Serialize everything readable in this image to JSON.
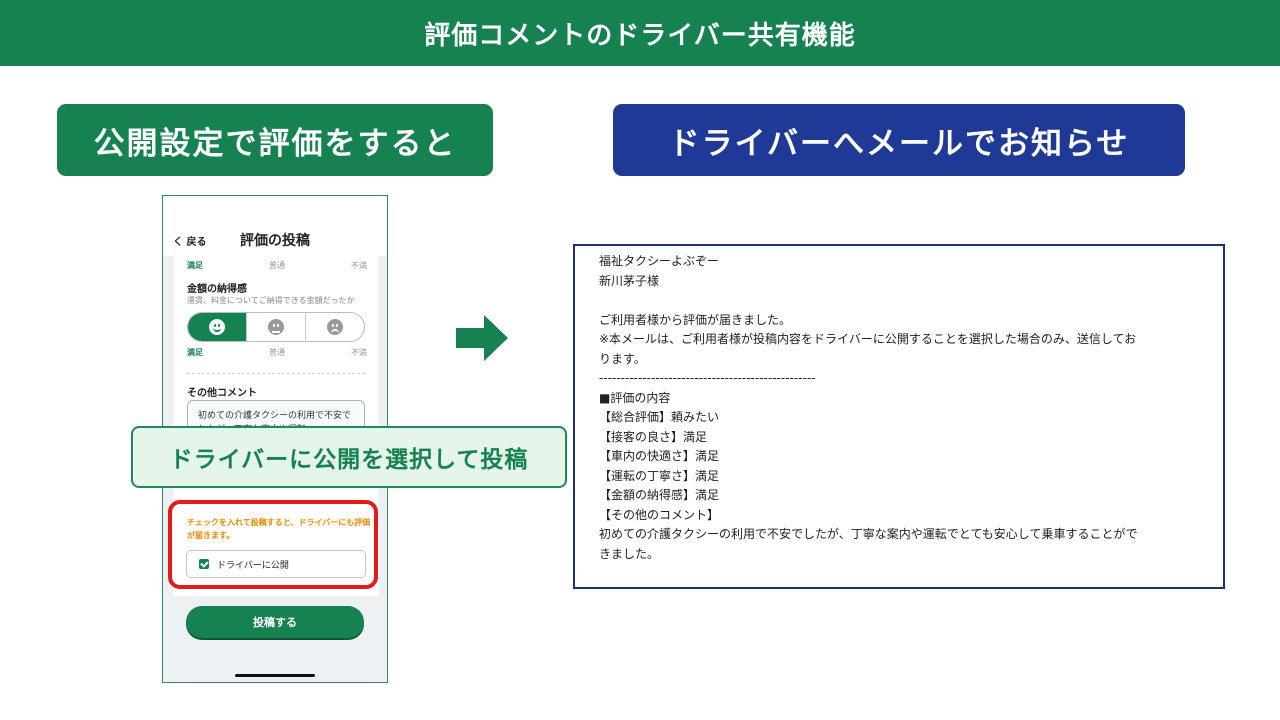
{
  "header": {
    "title": "評価コメントのドライバー共有機能"
  },
  "steps": {
    "left_label": "公開設定で評価をすると",
    "right_label": "ドライバーへメールでお知らせ"
  },
  "phone": {
    "back_label": "く 戻る",
    "title": "評価の投稿",
    "rating_labels": [
      "満足",
      "普通",
      "不満"
    ],
    "price_section": {
      "title": "金額の納得感",
      "subtitle": "運賃、料金についてご納得できる金額だったか"
    },
    "faces": [
      "smile-icon",
      "neutral-icon",
      "sad-icon"
    ],
    "comment_section": {
      "title": "その他コメント",
      "text": "初めての介護タクシーの利用で不安でしたが、丁寧な案内や運転"
    },
    "notice": "チェックを入れて投稿すると、ドライバーにも評価が届きます。",
    "checkbox_label": "ドライバーに公開",
    "submit_label": "投稿する"
  },
  "callout": {
    "text": "ドライバーに公開を選択して投稿"
  },
  "email": {
    "lines": [
      "福祉タクシーよぶぞー",
      "新川茅子様",
      "",
      "ご利用者様から評価が届きました。",
      "※本メールは、ご利用者様が投稿内容をドライバーに公開することを選択した場合のみ、送信してお",
      "ります。",
      "--------------------------------------------------",
      "■評価の内容",
      "【総合評価】頼みたい",
      "【接客の良さ】満足",
      "【車内の快適さ】満足",
      "【運転の丁寧さ】満足",
      "【金額の納得感】満足",
      "【その他のコメント】",
      "初めての介護タクシーの利用で不安でしたが、丁寧な案内や運転でとても安心して乗車することがで",
      "きました。"
    ]
  },
  "colors": {
    "green": "#168252",
    "navy": "#1f3997",
    "red": "#e41b1b",
    "orange": "#f08a00"
  }
}
